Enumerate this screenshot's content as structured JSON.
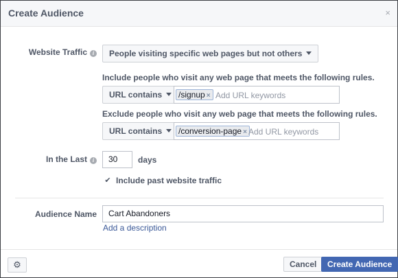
{
  "dialog": {
    "title": "Create Audience",
    "close_glyph": "×"
  },
  "website_traffic": {
    "label": "Website Traffic",
    "info_glyph": "i",
    "selected": "People visiting specific web pages but not others"
  },
  "include_rule": {
    "heading": "Include people who visit any web page that meets the following rules.",
    "operator": "URL contains",
    "tokens": [
      "/signup"
    ],
    "token_remove_glyph": "×",
    "placeholder": "Add URL keywords"
  },
  "exclude_rule": {
    "heading": "Exclude people who visit any web page that meets the following rules.",
    "operator": "URL contains",
    "tokens": [
      "/conversion-page"
    ],
    "token_remove_glyph": "×",
    "placeholder": "Add URL keywords"
  },
  "in_the_last": {
    "label": "In the Last",
    "info_glyph": "i",
    "value": "30",
    "unit": "days"
  },
  "include_past": {
    "checked": true,
    "check_glyph": "✔",
    "label": "Include past website traffic"
  },
  "audience_name": {
    "label": "Audience Name",
    "value": "Cart Abandoners",
    "add_description_link": "Add a description"
  },
  "footer": {
    "settings_icon": "gear-icon",
    "gear_glyph": "⚙",
    "cancel_label": "Cancel",
    "create_label": "Create Audience"
  },
  "colors": {
    "primary": "#4267b2",
    "link": "#3b5998",
    "label": "#4e5665"
  }
}
